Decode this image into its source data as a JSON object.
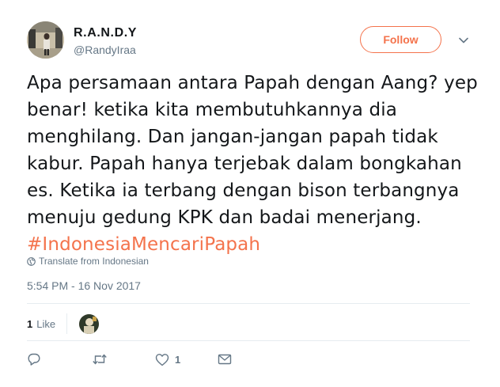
{
  "user": {
    "display_name": "R.A.N.D.Y",
    "screen_name": "@RandyIraa"
  },
  "follow_button": {
    "label": "Follow",
    "accent_color": "#f4734c"
  },
  "tweet": {
    "text": "Apa persamaan antara Papah dengan Aang? yep benar! ketika kita membutuhkannya dia menghilang. Dan jangan-jangan papah tidak kabur. Papah hanya terjebak dalam bongkahan es. Ketika ia terbang dengan bison terbangnya menuju gedung KPK dan badai menerjang.",
    "hashtag": "#IndonesiaMencariPapah"
  },
  "translate_link": {
    "label": "Translate from Indonesian",
    "icon": "globe-icon"
  },
  "timestamp": "5:54 PM - 16 Nov 2017",
  "stats": {
    "likes_count": "1",
    "likes_label": "Like"
  },
  "actions": {
    "reply_icon": "reply-icon",
    "retweet_icon": "retweet-icon",
    "like_icon": "heart-icon",
    "like_count": "1",
    "dm_icon": "envelope-icon"
  },
  "colors": {
    "text": "#14171a",
    "secondary_text": "#657786",
    "divider": "#e6ecf0",
    "accent": "#f4734c"
  }
}
